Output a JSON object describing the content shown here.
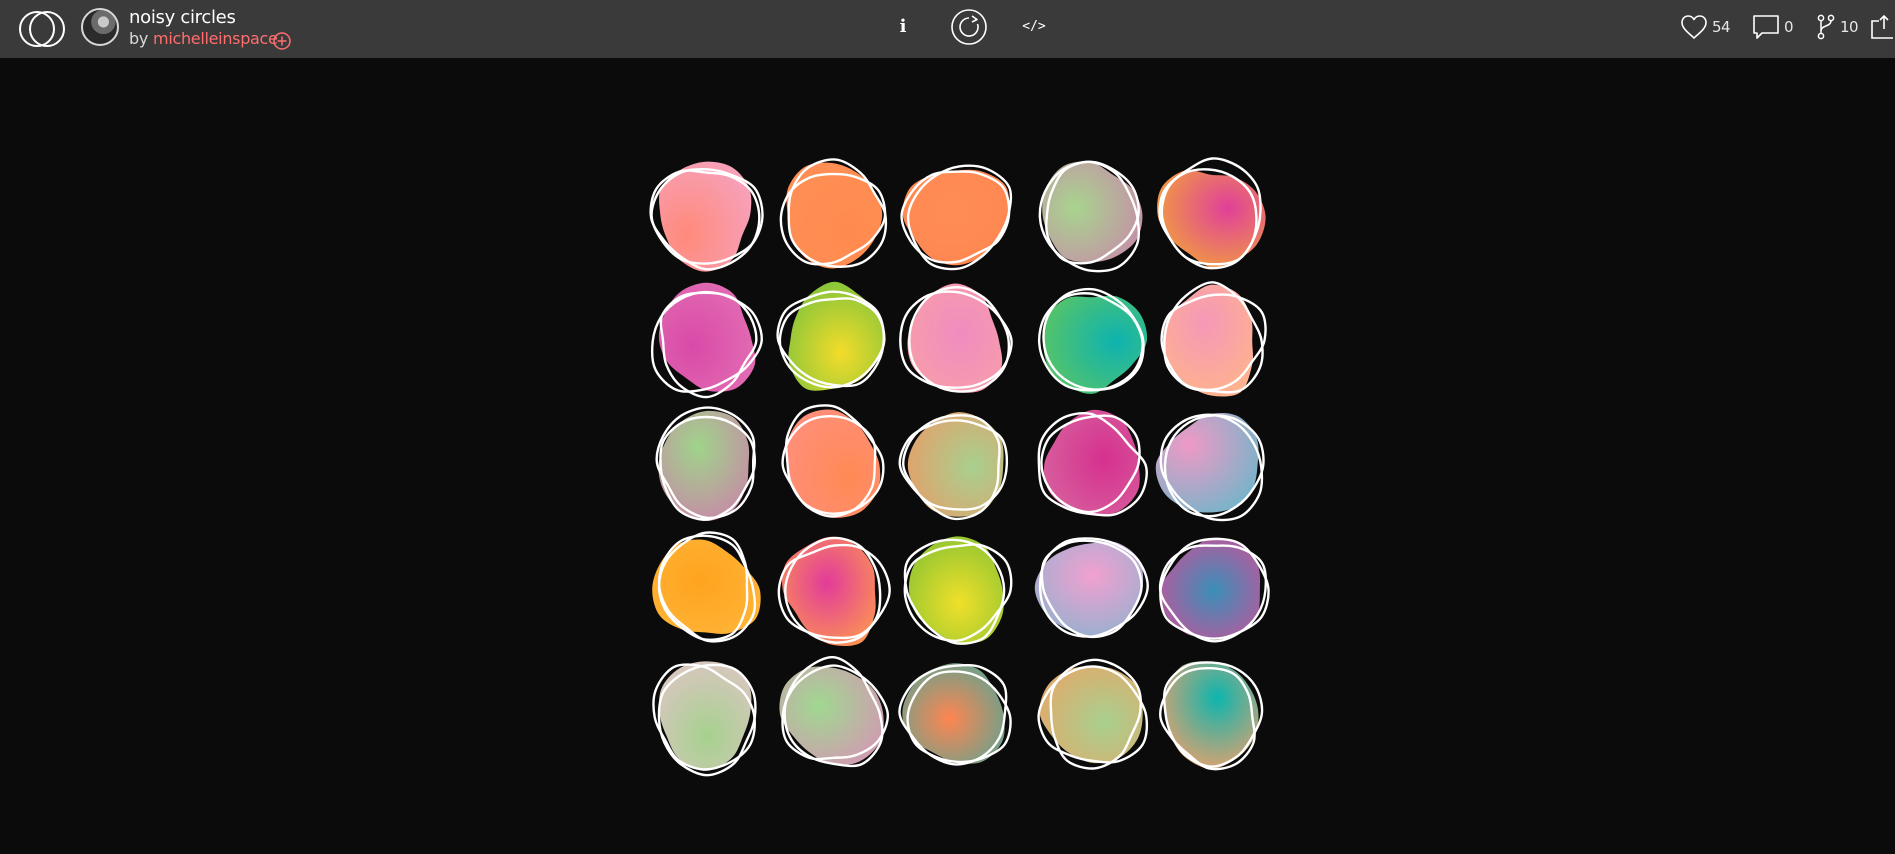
{
  "header": {
    "title": "noisy circles",
    "by_prefix": "by",
    "author": "michelleinspace",
    "actions": {
      "info_label": "i",
      "code_label": "</>"
    },
    "stats": {
      "likes": "54",
      "comments": "0",
      "forks": "10"
    }
  },
  "icons": {
    "logo": "openprocessing-logo-icon",
    "avatar": "user-avatar",
    "follow": "plus-circle-icon",
    "info": "info-icon",
    "replay": "replay-icon",
    "code": "code-icon",
    "likes": "heart-icon",
    "comments": "comment-icon",
    "forks": "fork-icon",
    "share": "share-icon"
  },
  "colors": {
    "topbar": "#3a3a3a",
    "canvas": "#0b0b0b",
    "accent": "#ff6e6e",
    "outline": "#ffffff"
  },
  "artwork": {
    "grid": "5x5",
    "blobs": [
      {
        "c1": "#ff8a7a",
        "c2": "#f7a0b8"
      },
      {
        "c1": "#ff8a4e",
        "c2": "#ff8f55"
      },
      {
        "c1": "#ff8d55",
        "c2": "#ff8650"
      },
      {
        "c1": "#a8d48e",
        "c2": "#c68ea8"
      },
      {
        "c1": "#e0409a",
        "c2": "#f2a33a"
      },
      {
        "c1": "#d94aa8",
        "c2": "#e36fb4"
      },
      {
        "c1": "#f4dc2a",
        "c2": "#78c23c"
      },
      {
        "c1": "#f08cc0",
        "c2": "#f9a0a6"
      },
      {
        "c1": "#0eb3b0",
        "c2": "#58c466"
      },
      {
        "c1": "#f598b8",
        "c2": "#ffb48a"
      },
      {
        "c1": "#9fd48a",
        "c2": "#c888a8"
      },
      {
        "c1": "#ff8a55",
        "c2": "#ff8f7a"
      },
      {
        "c1": "#a8d08e",
        "c2": "#e4a06a"
      },
      {
        "c1": "#d6308f",
        "c2": "#d7649e"
      },
      {
        "c1": "#f099c6",
        "c2": "#7ab3c9"
      },
      {
        "c1": "#ffa31f",
        "c2": "#ffb63a"
      },
      {
        "c1": "#e23b9a",
        "c2": "#ffa04a"
      },
      {
        "c1": "#f0e02a",
        "c2": "#84c232"
      },
      {
        "c1": "#f2a0d0",
        "c2": "#8fb2cf"
      },
      {
        "c1": "#3a8fb8",
        "c2": "#d84b96"
      },
      {
        "c1": "#a6d18e",
        "c2": "#dcc6c2"
      },
      {
        "c1": "#a0d890",
        "c2": "#d497b4"
      },
      {
        "c1": "#ff8550",
        "c2": "#48a89a"
      },
      {
        "c1": "#a8d08e",
        "c2": "#e4a86a"
      },
      {
        "c1": "#0db5ae",
        "c2": "#f0a06a"
      }
    ]
  }
}
